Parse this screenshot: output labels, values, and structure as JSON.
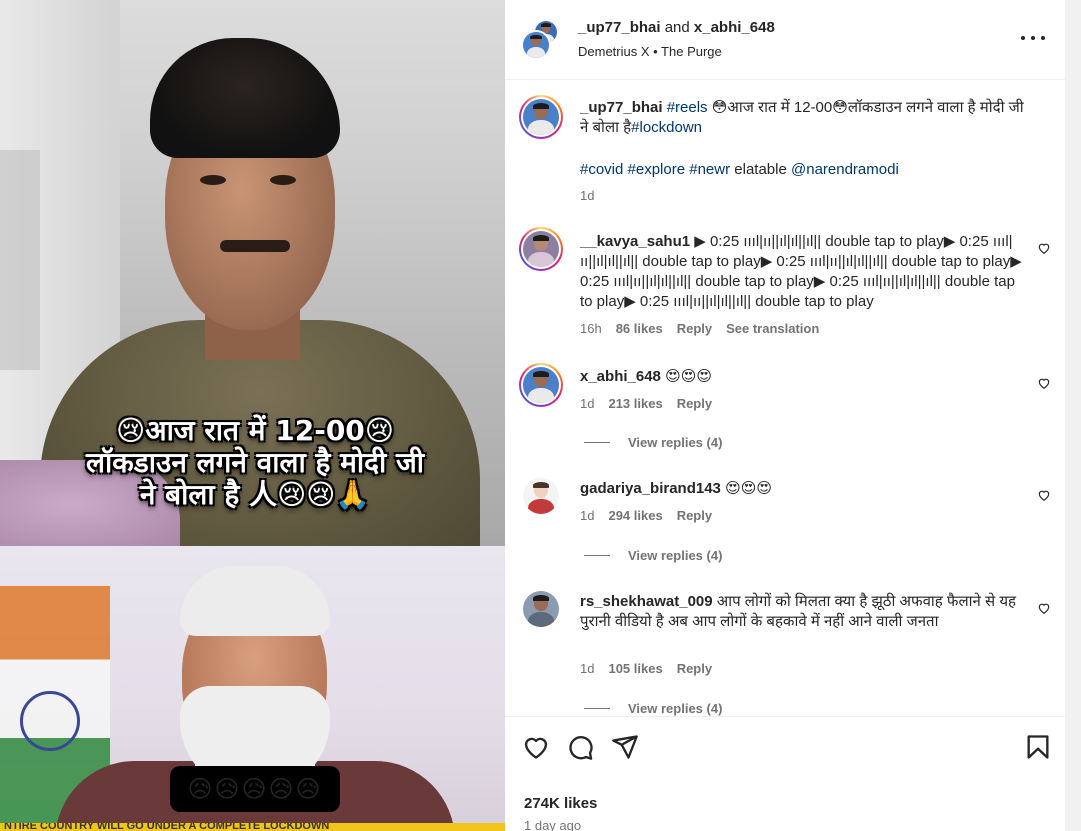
{
  "media": {
    "overlay_line1": "😢आज रात में 12-00😢",
    "overlay_line2": "लॉकडाउन लगने वाला है मोदी जी",
    "overlay_line3": "ने बोला है 人😢😢🙏",
    "emoji_box": "😥😥😥😥😥",
    "ticker": "NTIRE COUNTRY WILL GO UNDER A COMPLETE LOCKDOWN"
  },
  "header": {
    "user1": "_up77_bhai",
    "and": "and",
    "user2": "x_abhi_648",
    "audio": "Demetrius X • The Purge"
  },
  "caption": {
    "username": "_up77_bhai",
    "tag_reels": "#reels",
    "text1": "😳आज रात में 12-00😳लॉकडाउन लगने वाला है",
    "text2": "मोदी जी ने बोला है",
    "tag_lockdown": "#lockdown",
    "tags_line": {
      "covid": "#covid",
      "explore": "#explore",
      "newr": "#newr",
      "elatable": "elatable",
      "mention": "@narendramodi"
    },
    "time": "1d"
  },
  "comments": [
    {
      "username": "__kavya_sahu1",
      "text": "▶ 0:25 ıııl|ıı||ıl|ıl||ıl|| double tap to play▶ 0:25 ıııl|ıı||ıl|ıl||ıl|| double tap to play▶ 0:25 ıııl|ıı||ıl|ıl||ıl|| double tap to play▶ 0:25 ıııl|ıı||ıl|ıl||ıl|| double tap to play▶ 0:25 ıııl|ıı||ıl|ıl||ıl|| double tap to play▶ 0:25 ıııl|ıı||ıl|ıl||ıl|| double tap to play",
      "time": "16h",
      "likes": "86 likes",
      "reply": "Reply",
      "translate": "See translation"
    },
    {
      "username": "x_abhi_648",
      "text": "😍😍😍",
      "time": "1d",
      "likes": "213 likes",
      "reply": "Reply",
      "view_replies": "View replies (4)"
    },
    {
      "username": "gadariya_birand143",
      "text": "😍😍😍",
      "time": "1d",
      "likes": "294 likes",
      "reply": "Reply",
      "view_replies": "View replies (4)"
    },
    {
      "username": "rs_shekhawat_009",
      "text": "आप लोगों को मिलता क्या है झूठी अफवाह फैलाने से यह पुरानी वीडियो है अब आप लोगों के बहकावे में नहीं आने वाली जनता",
      "time": "1d",
      "likes": "105 likes",
      "reply": "Reply",
      "view_replies": "View replies (4)"
    }
  ],
  "footer": {
    "likes": "274K likes",
    "ago": "1 day ago"
  },
  "icons": [
    "heart-icon",
    "comment-icon",
    "share-icon",
    "bookmark-icon",
    "more-icon"
  ]
}
